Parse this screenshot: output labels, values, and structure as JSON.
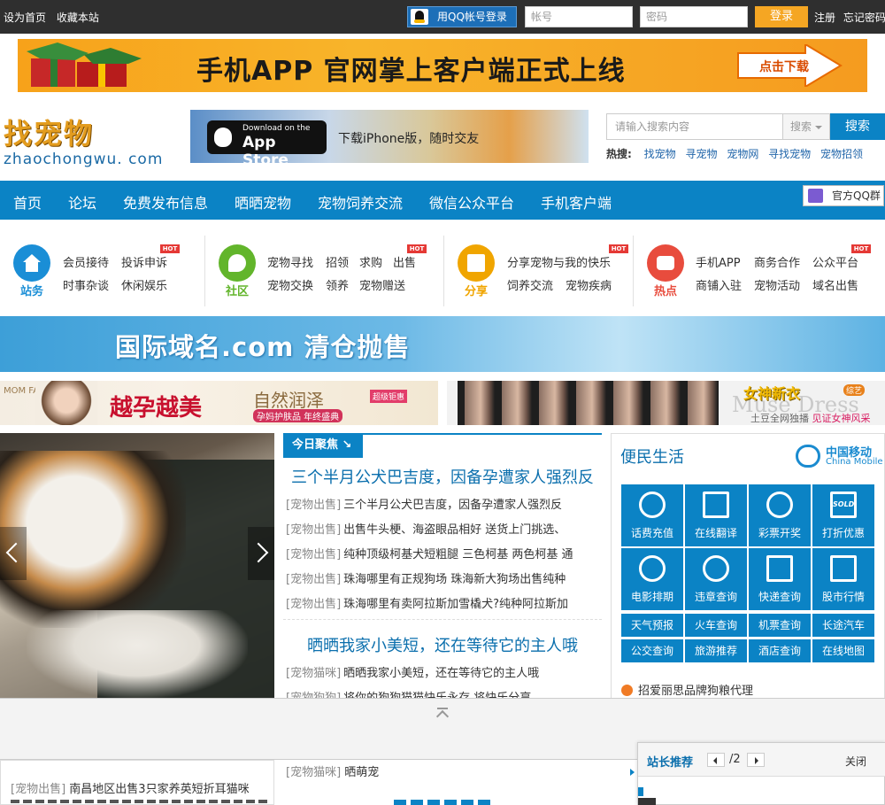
{
  "topbar": {
    "set_home": "设为首页",
    "bookmark": "收藏本站",
    "qq_login": "用QQ帐号登录",
    "account_placeholder": "帐号",
    "password_placeholder": "密码",
    "login": "登录",
    "register": "注册",
    "forgot_password": "忘记密码"
  },
  "banner_top": {
    "text": "手机APP 官网掌上客户端正式上线",
    "cta": "点击下载"
  },
  "logo": {
    "cn": "找宠物",
    "en": "zhaochongwu. com"
  },
  "app_banner": {
    "line1": "Download on the",
    "line2": "App Store",
    "text": "下载iPhone版，随时交友"
  },
  "search": {
    "placeholder": "请输入搜索内容",
    "select_label": "搜索",
    "button": "搜索",
    "hot_label": "热搜:",
    "hot_words": [
      "找宠物",
      "寻宠物",
      "宠物网",
      "寻找宠物",
      "宠物招领"
    ]
  },
  "nav": {
    "items": [
      "首页",
      "论坛",
      "免费发布信息",
      "晒晒宠物",
      "宠物饲养交流",
      "微信公众平台",
      "手机客户端"
    ],
    "qq_group": "官方QQ群"
  },
  "categories": [
    {
      "label": "站务",
      "color": "#1a8ed6",
      "links": [
        "会员接待",
        "投诉申诉",
        "时事杂谈",
        "休闲娱乐"
      ],
      "hot": "HOT"
    },
    {
      "label": "社区",
      "color": "#62b52b",
      "links": [
        "宠物寻找",
        "招领",
        "求购",
        "出售",
        "宠物交换",
        "领养",
        "宠物赠送"
      ],
      "hot": "HOT"
    },
    {
      "label": "分享",
      "color": "#f0a500",
      "links": [
        "分享宠物与我的快乐",
        "饲养交流",
        "宠物疾病"
      ],
      "hot": "HOT"
    },
    {
      "label": "热点",
      "color": "#e84c3d",
      "links": [
        "手机APP",
        "商务合作",
        "公众平台",
        "商铺入驻",
        "宠物活动",
        "域名出售"
      ],
      "hot": "HOT"
    }
  ],
  "domain_banner": {
    "text": "国际域名.com 清仓抛售"
  },
  "ad_left": {
    "brand": "MOM FACE",
    "headline": "越孕越美",
    "sub1": "自然润泽",
    "sub2": "孕妈护肤品 年终盛典",
    "badge": "超级钜惠"
  },
  "ad_right": {
    "logo": "女神新衣",
    "tag": "综艺",
    "muse": "Muse Dress",
    "sub_a": "土豆全网独播",
    "sub_b": "见证女神风采"
  },
  "focus": {
    "tab": "今日聚焦",
    "headline1": "三个半月公犬巴吉度，因备孕遭家人强烈反",
    "list1": [
      {
        "cat": "[宠物出售]",
        "text": "三个半月公犬巴吉度，因备孕遭家人强烈反"
      },
      {
        "cat": "[宠物出售]",
        "text": "出售牛头梗、海盗眼品相好 送货上门挑选、"
      },
      {
        "cat": "[宠物出售]",
        "text": "纯种顶级柯基犬短粗腿 三色柯基 两色柯基 通"
      },
      {
        "cat": "[宠物出售]",
        "text": "珠海哪里有正规狗场 珠海新大狗场出售纯种"
      },
      {
        "cat": "[宠物出售]",
        "text": "珠海哪里有卖阿拉斯加雪橇犬?纯种阿拉斯加"
      }
    ],
    "headline2": "晒晒我家小美短，还在等待它的主人哦",
    "list2": [
      {
        "cat": "[宠物猫咪]",
        "text": "晒晒我家小美短，还在等待它的主人哦"
      },
      {
        "cat": "[宠物狗狗]",
        "text": "将你的狗狗猫猫快乐永存 将快乐分享"
      }
    ]
  },
  "life": {
    "title": "便民生活",
    "carrier_cn": "中国移动",
    "carrier_en": "China Mobile",
    "tiles": [
      "话费充值",
      "在线翻译",
      "彩票开奖",
      "打折优惠",
      "电影排期",
      "违章查询",
      "快递查询",
      "股市行情"
    ],
    "tile_icon_badge": "SOLD",
    "small": [
      "天气预报",
      "火车查询",
      "机票查询",
      "长途汽车",
      "公交查询",
      "旅游推荐",
      "酒店查询",
      "在线地图"
    ],
    "notice": "招爱丽思品牌狗粮代理"
  },
  "bottom": {
    "left_cat": "[宠物出售]",
    "left_text": "南昌地区出售3只家养英短折耳猫咪",
    "mid_cat": "[宠物猫咪]",
    "mid_text": "晒萌宠"
  },
  "popup": {
    "title": "站长推荐",
    "page": "/2",
    "close": "关闭"
  }
}
